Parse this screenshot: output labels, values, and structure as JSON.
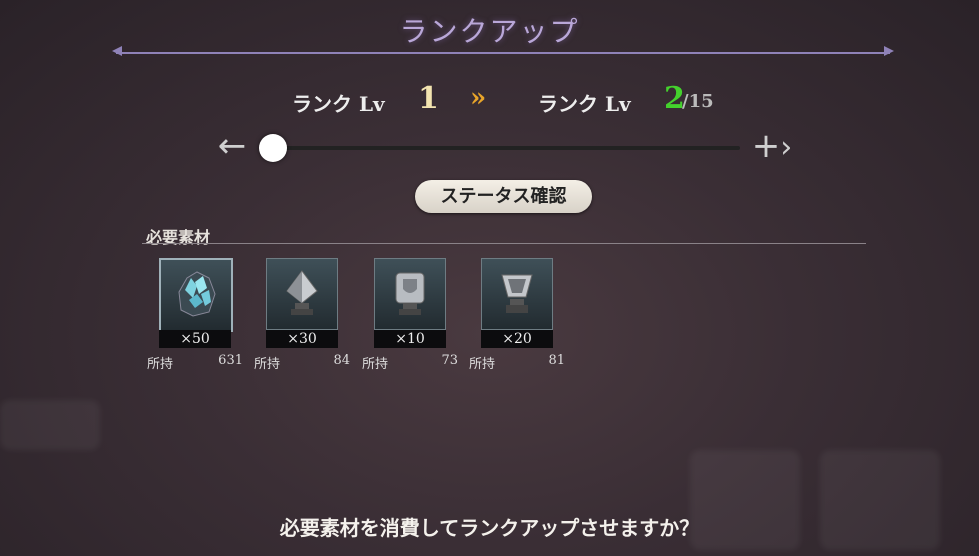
{
  "header": {
    "title": "ランクアップ"
  },
  "rank": {
    "current_label": "ランク Lv",
    "current_level": "1",
    "separator": "»",
    "next_label": "ランク Lv",
    "next_level": "2",
    "max_level": "/15",
    "next_color": "#44d12d",
    "current_color": "#f3e4b0"
  },
  "slider": {
    "minus_label": "←",
    "plus_label": "+",
    "position_fraction": 0.0
  },
  "status_button": {
    "label": "ステータス確認"
  },
  "materials": {
    "header": "必要素材",
    "items": [
      {
        "icon": "crystal-icon",
        "qty": "×50",
        "own_label": "所持",
        "own_value": "631"
      },
      {
        "icon": "silver-pyramid-icon",
        "qty": "×30",
        "own_label": "所持",
        "own_value": "84"
      },
      {
        "icon": "silver-shield-icon",
        "qty": "×10",
        "own_label": "所持",
        "own_value": "73"
      },
      {
        "icon": "silver-gem-icon",
        "qty": "×20",
        "own_label": "所持",
        "own_value": "81"
      }
    ]
  },
  "footer": {
    "question": "必要素材を消費してランクアップさせますか？"
  }
}
